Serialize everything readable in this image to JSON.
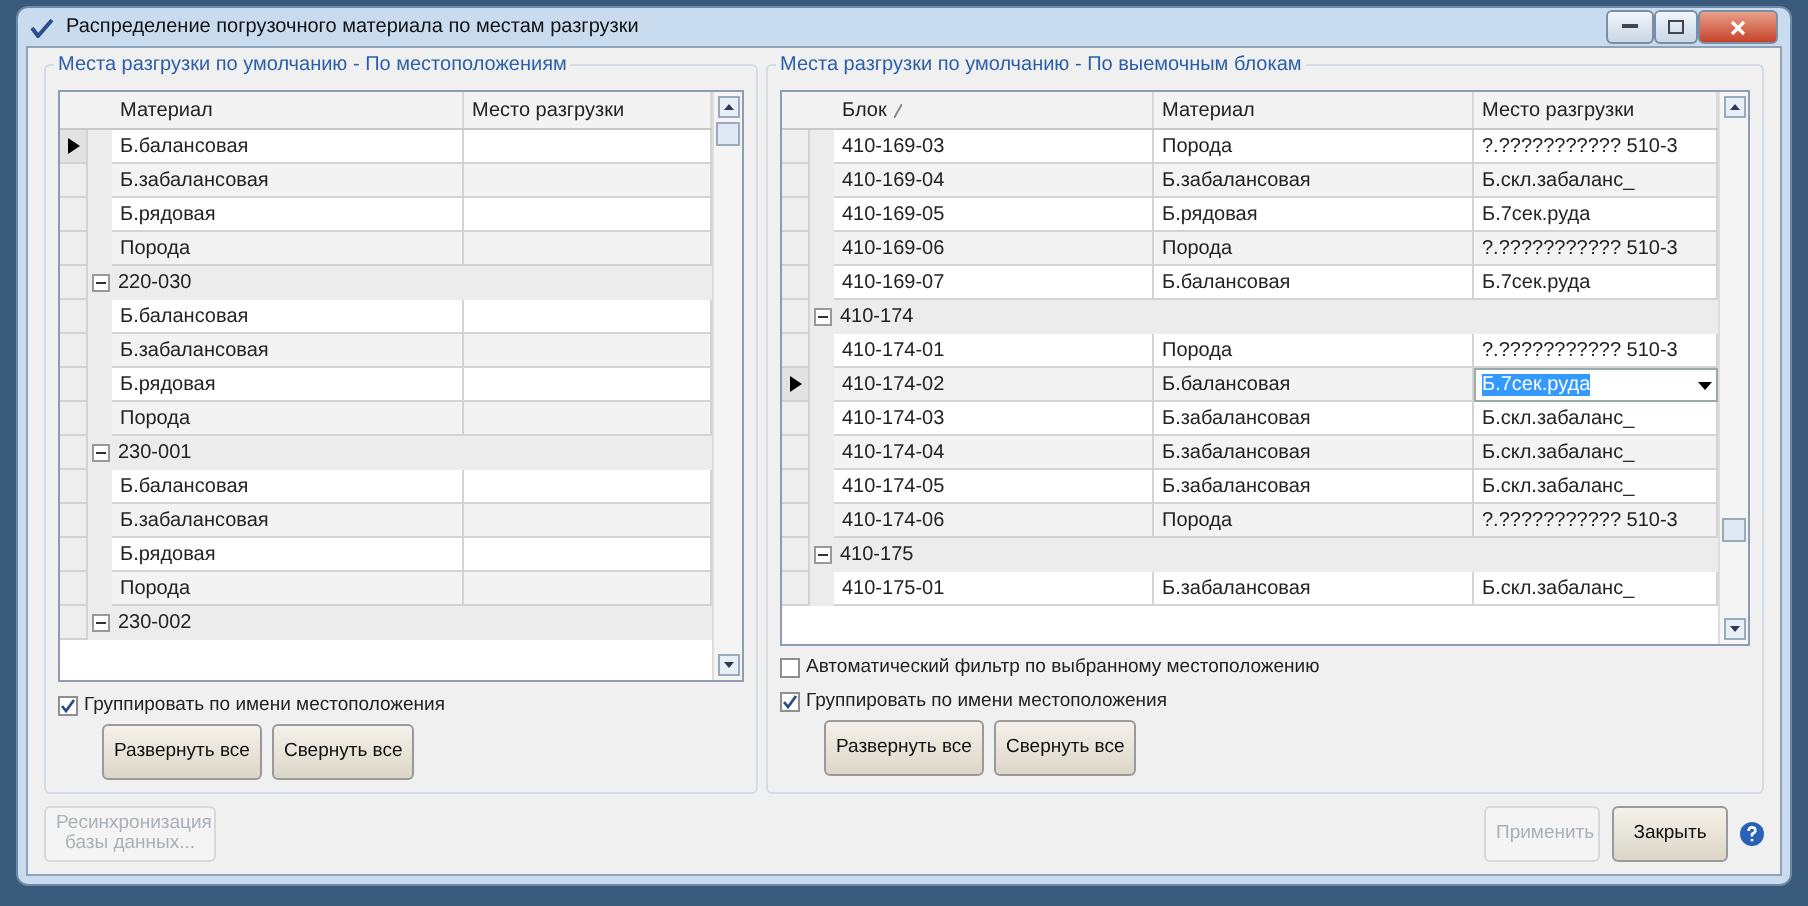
{
  "window": {
    "title": "Распределение погрузочного материала по местам разгрузки"
  },
  "left_panel": {
    "title": "Места разгрузки по умолчанию - По местоположениям",
    "columns": [
      "Материал",
      "Место разгрузки"
    ],
    "rows": [
      {
        "kind": "row",
        "material": "Б.балансовая",
        "selected": true
      },
      {
        "kind": "row",
        "material": "Б.забалансовая",
        "selected": false
      },
      {
        "kind": "row",
        "material": "Б.рядовая",
        "selected": false
      },
      {
        "kind": "row",
        "material": "Порода",
        "selected": false
      },
      {
        "kind": "group",
        "name": "220-030",
        "expanded": true
      },
      {
        "kind": "row",
        "material": "Б.балансовая",
        "selected": false
      },
      {
        "kind": "row",
        "material": "Б.забалансовая",
        "selected": false
      },
      {
        "kind": "row",
        "material": "Б.рядовая",
        "selected": false
      },
      {
        "kind": "row",
        "material": "Порода",
        "selected": false
      },
      {
        "kind": "group",
        "name": "230-001",
        "expanded": true
      },
      {
        "kind": "row",
        "material": "Б.балансовая",
        "selected": false
      },
      {
        "kind": "row",
        "material": "Б.забалансовая",
        "selected": false
      },
      {
        "kind": "row",
        "material": "Б.рядовая",
        "selected": false
      },
      {
        "kind": "row",
        "material": "Порода",
        "selected": false
      },
      {
        "kind": "group",
        "name": "230-002",
        "expanded": true
      }
    ],
    "checkboxes": [
      {
        "label": "Группировать по имени местоположения",
        "checked": true
      }
    ],
    "buttons": [
      {
        "label": "Развернуть все",
        "disabled": false
      },
      {
        "label": "Свернуть все",
        "disabled": false
      }
    ]
  },
  "right_panel": {
    "title": "Места разгрузки по умолчанию - По выемочным блокам",
    "columns": [
      "Блок",
      "Материал",
      "Место разгрузки"
    ],
    "rows": [
      {
        "kind": "row",
        "block": "410-169-03",
        "material": "Порода",
        "place": "?.??????????? 510-3",
        "selected": false
      },
      {
        "kind": "row",
        "block": "410-169-04",
        "material": "Б.забалансовая",
        "place": "Б.скл.забаланс_",
        "selected": false
      },
      {
        "kind": "row",
        "block": "410-169-05",
        "material": "Б.рядовая",
        "place": "Б.7сек.руда",
        "selected": false
      },
      {
        "kind": "row",
        "block": "410-169-06",
        "material": "Порода",
        "place": "?.??????????? 510-3",
        "selected": false
      },
      {
        "kind": "row",
        "block": "410-169-07",
        "material": "Б.балансовая",
        "place": "Б.7сек.руда",
        "selected": false
      },
      {
        "kind": "group",
        "name": "410-174",
        "expanded": true
      },
      {
        "kind": "row",
        "block": "410-174-01",
        "material": "Порода",
        "place": "?.??????????? 510-3",
        "selected": false
      },
      {
        "kind": "row",
        "block": "410-174-02",
        "material": "Б.балансовая",
        "place": "Б.7сек.руда",
        "selected": true
      },
      {
        "kind": "row",
        "block": "410-174-03",
        "material": "Б.забалансовая",
        "place": "Б.скл.забаланс_",
        "selected": false
      },
      {
        "kind": "row",
        "block": "410-174-04",
        "material": "Б.забалансовая",
        "place": "Б.скл.забаланс_",
        "selected": false
      },
      {
        "kind": "row",
        "block": "410-174-05",
        "material": "Б.забалансовая",
        "place": "Б.скл.забаланс_",
        "selected": false
      },
      {
        "kind": "row",
        "block": "410-174-06",
        "material": "Порода",
        "place": "?.??????????? 510-3",
        "selected": false
      },
      {
        "kind": "group",
        "name": "410-175",
        "expanded": true
      },
      {
        "kind": "row",
        "block": "410-175-01",
        "material": "Б.забалансовая",
        "place": "Б.скл.забаланс_",
        "selected": false
      }
    ],
    "checkboxes": [
      {
        "label": "Автоматический фильтр по выбранному местоположению",
        "checked": false
      },
      {
        "label": "Группировать по имени местоположения",
        "checked": true
      }
    ],
    "buttons": [
      {
        "label": "Развернуть все",
        "disabled": false
      },
      {
        "label": "Свернуть все",
        "disabled": false
      }
    ]
  },
  "footer": {
    "buttons": [
      {
        "label": "Ресинхронизация базы данных...",
        "disabled": true
      },
      {
        "label": "Применить",
        "disabled": true
      },
      {
        "label": "Закрыть",
        "disabled": false
      }
    ]
  }
}
